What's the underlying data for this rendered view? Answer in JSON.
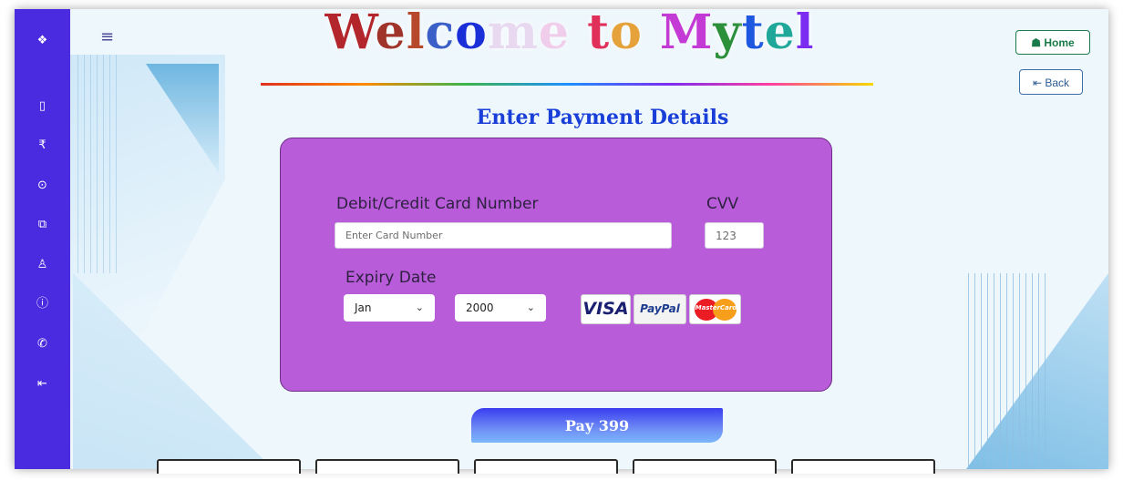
{
  "sidebar": {
    "icons": [
      "layers-icon",
      "mobile-icon",
      "rupee-icon",
      "arrow-circle-icon",
      "copy-icon",
      "user-icon",
      "info-icon",
      "phone-icon",
      "logout-icon"
    ],
    "glyphs": [
      "❖",
      "▯",
      "₹",
      "⊙",
      "⧉",
      "♙",
      "ⓘ",
      "✆",
      "⇤"
    ]
  },
  "header": {
    "menu_glyph": "≡",
    "title_parts": [
      {
        "text": "W",
        "color": "#b3262c"
      },
      {
        "text": "e",
        "color": "#a0342a"
      },
      {
        "text": "l",
        "color": "#b7482b"
      },
      {
        "text": "c",
        "color": "#3a5fc7"
      },
      {
        "text": "o",
        "color": "#1a2fd8"
      },
      {
        "text": "m",
        "color": "#e8d9f0"
      },
      {
        "text": "e",
        "color": "#f0cdea"
      },
      {
        "text": " ",
        "color": "#ffffff"
      },
      {
        "text": "t",
        "color": "#e0305a"
      },
      {
        "text": "o",
        "color": "#e6a23a"
      },
      {
        "text": " ",
        "color": "#ffffff"
      },
      {
        "text": "M",
        "color": "#c43ad4"
      },
      {
        "text": "y",
        "color": "#2c8f3a"
      },
      {
        "text": "t",
        "color": "#1f58e0"
      },
      {
        "text": "e",
        "color": "#1fa89a"
      },
      {
        "text": "l",
        "color": "#7b2cf0"
      }
    ],
    "home_label": "Home",
    "home_glyph": "☗",
    "back_label": "Back",
    "back_glyph": "⇤"
  },
  "page": {
    "subtitle": "Enter Payment Details"
  },
  "form": {
    "card_label": "Debit/Credit Card Number",
    "card_placeholder": "Enter Card Number",
    "cvv_label": "CVV",
    "cvv_placeholder": "123",
    "expiry_label": "Expiry Date",
    "month_value": "Jan",
    "year_value": "2000",
    "chevron": "⌄",
    "logos": {
      "visa": "VISA",
      "paypal": "PayPal",
      "mastercard": "MasterCard"
    }
  },
  "pay_button": "Pay 399",
  "colors": {
    "sidebar": "#4a2be0",
    "card_bg": "#b95cd9",
    "subtitle": "#1a3fd8",
    "pay_button": "#3a3df0"
  }
}
